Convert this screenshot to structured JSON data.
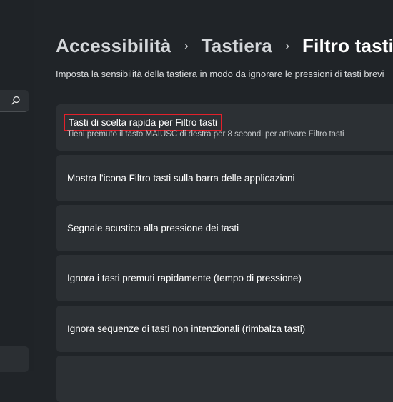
{
  "breadcrumb": {
    "items": [
      "Accessibilità",
      "Tastiera",
      "Filtro tasti"
    ],
    "separator": "›"
  },
  "description": "Imposta la sensibilità della tastiera in modo da ignorare le pressioni di tasti brevi",
  "sidebar": {
    "search_icon": "search-icon"
  },
  "cards": [
    {
      "title": "Tasti di scelta rapida per Filtro tasti",
      "subtitle": "Tieni premuto il tasto MAIUSC di destra per 8 secondi per attivare Filtro tasti",
      "highlighted": true,
      "highlight_color": "#e3202a"
    },
    {
      "title": "Mostra l'icona Filtro tasti sulla barra delle applicazioni"
    },
    {
      "title": "Segnale acustico alla pressione dei tasti"
    },
    {
      "title": "Ignora i tasti premuti rapidamente (tempo di pressione)"
    },
    {
      "title": "Ignora sequenze di tasti non intenzionali (rimbalza tasti)"
    }
  ],
  "colors": {
    "background": "#202428",
    "card": "#2c3034",
    "highlight": "#e3202a"
  }
}
